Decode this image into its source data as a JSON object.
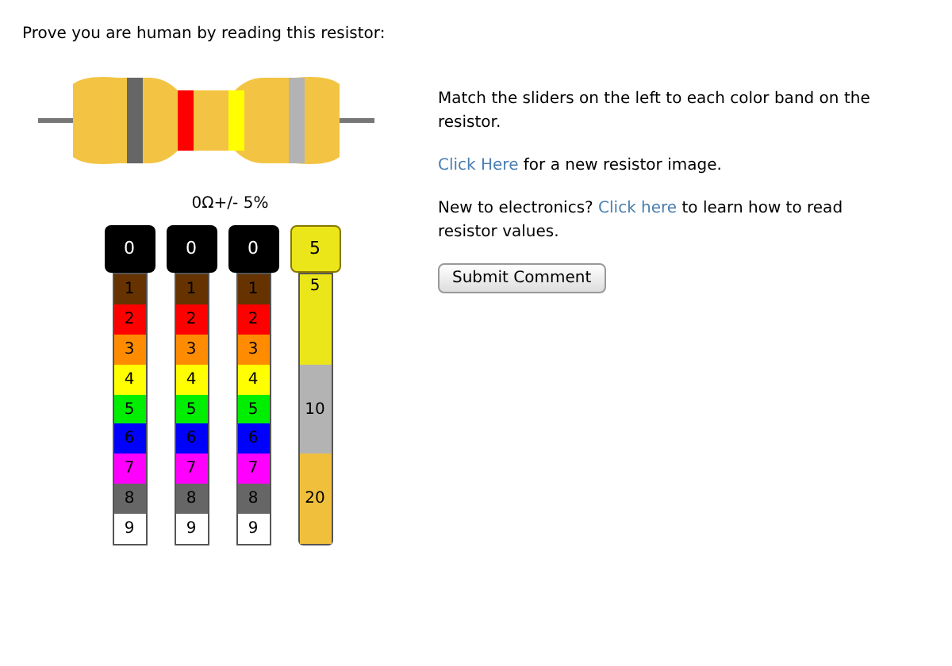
{
  "heading": "Prove you are human by reading this resistor:",
  "resistor": {
    "bands": [
      {
        "color": "#666666"
      },
      {
        "color": "#ff0000"
      },
      {
        "color": "#ffff00"
      },
      {
        "color": "#b3b3b3"
      }
    ]
  },
  "reading": "0Ω+/- 5%",
  "sliders": [
    {
      "kind": "digit",
      "handle": {
        "value": "0",
        "color": "#000000"
      },
      "bands": [
        {
          "label": "1",
          "color": "#663300"
        },
        {
          "label": "2",
          "color": "#ff0000"
        },
        {
          "label": "3",
          "color": "#ff8c00"
        },
        {
          "label": "4",
          "color": "#ffff00"
        },
        {
          "label": "5",
          "color": "#00ee00"
        },
        {
          "label": "6",
          "color": "#0000ff"
        },
        {
          "label": "7",
          "color": "#ff00ff"
        },
        {
          "label": "8",
          "color": "#666666"
        },
        {
          "label": "9",
          "color": "#ffffff"
        }
      ]
    },
    {
      "kind": "digit",
      "handle": {
        "value": "0",
        "color": "#000000"
      },
      "bands": [
        {
          "label": "1",
          "color": "#663300"
        },
        {
          "label": "2",
          "color": "#ff0000"
        },
        {
          "label": "3",
          "color": "#ff8c00"
        },
        {
          "label": "4",
          "color": "#ffff00"
        },
        {
          "label": "5",
          "color": "#00ee00"
        },
        {
          "label": "6",
          "color": "#0000ff"
        },
        {
          "label": "7",
          "color": "#ff00ff"
        },
        {
          "label": "8",
          "color": "#666666"
        },
        {
          "label": "9",
          "color": "#ffffff"
        }
      ]
    },
    {
      "kind": "digit",
      "handle": {
        "value": "0",
        "color": "#000000"
      },
      "bands": [
        {
          "label": "1",
          "color": "#663300"
        },
        {
          "label": "2",
          "color": "#ff0000"
        },
        {
          "label": "3",
          "color": "#ff8c00"
        },
        {
          "label": "4",
          "color": "#ffff00"
        },
        {
          "label": "5",
          "color": "#00ee00"
        },
        {
          "label": "6",
          "color": "#0000ff"
        },
        {
          "label": "7",
          "color": "#ff00ff"
        },
        {
          "label": "8",
          "color": "#666666"
        },
        {
          "label": "9",
          "color": "#ffffff"
        }
      ]
    },
    {
      "kind": "tolerance",
      "handle": {
        "value": "5",
        "color": "#ebe61a"
      },
      "bands": [
        {
          "label": "5",
          "color": "#ebe61a"
        },
        {
          "label": "10",
          "color": "#b3b3b3"
        },
        {
          "label": "20",
          "color": "#f0c03c"
        }
      ]
    }
  ],
  "instructions": "Match the sliders on the left to each color band on the resistor.",
  "new_image": {
    "link": "Click Here",
    "text": " for a new resistor image."
  },
  "learn": {
    "before": "New to electronics? ",
    "link": "Click here",
    "after": " to learn how to read resistor values."
  },
  "submit": "Submit Comment"
}
